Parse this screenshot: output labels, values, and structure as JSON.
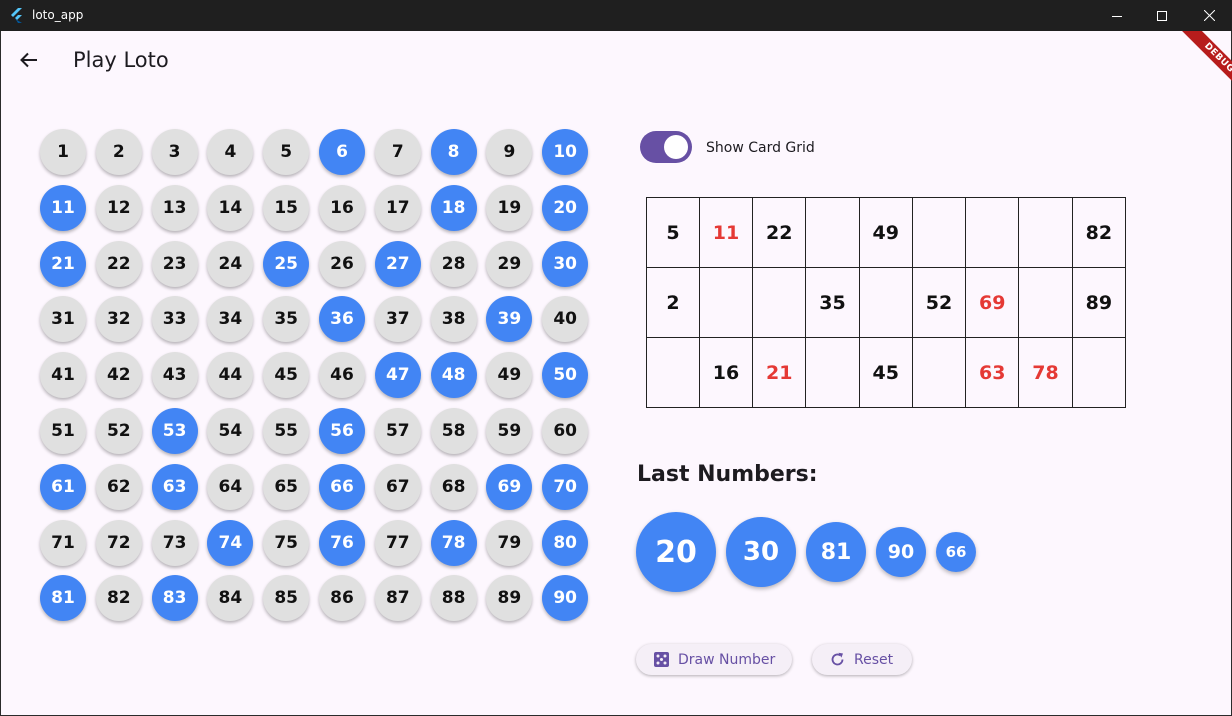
{
  "window": {
    "title": "loto_app",
    "icon": "flutter-logo-icon"
  },
  "appbar": {
    "title": "Play Loto",
    "back_icon": "arrow-back-icon"
  },
  "debug_banner": "DEBUG",
  "board": {
    "numbers": [
      1,
      2,
      3,
      4,
      5,
      6,
      7,
      8,
      9,
      10,
      11,
      12,
      13,
      14,
      15,
      16,
      17,
      18,
      19,
      20,
      21,
      22,
      23,
      24,
      25,
      26,
      27,
      28,
      29,
      30,
      31,
      32,
      33,
      34,
      35,
      36,
      37,
      38,
      39,
      40,
      41,
      42,
      43,
      44,
      45,
      46,
      47,
      48,
      49,
      50,
      51,
      52,
      53,
      54,
      55,
      56,
      57,
      58,
      59,
      60,
      61,
      62,
      63,
      64,
      65,
      66,
      67,
      68,
      69,
      70,
      71,
      72,
      73,
      74,
      75,
      76,
      77,
      78,
      79,
      80,
      81,
      82,
      83,
      84,
      85,
      86,
      87,
      88,
      89,
      90
    ],
    "drawn": [
      6,
      8,
      10,
      11,
      18,
      20,
      21,
      25,
      27,
      30,
      36,
      39,
      47,
      48,
      50,
      53,
      56,
      61,
      63,
      66,
      69,
      70,
      74,
      76,
      78,
      80,
      81,
      83,
      90
    ]
  },
  "toggle": {
    "label": "Show Card Grid",
    "on": true
  },
  "card": {
    "rows": [
      [
        "5",
        "11",
        "22",
        "",
        "49",
        "",
        "",
        "",
        "82"
      ],
      [
        "2",
        "",
        "",
        "35",
        "",
        "52",
        "69",
        "",
        "89"
      ],
      [
        "",
        "16",
        "21",
        "",
        "45",
        "",
        "63",
        "78",
        ""
      ]
    ]
  },
  "last_numbers": {
    "title": "Last Numbers:",
    "values": [
      "20",
      "30",
      "81",
      "90",
      "66"
    ]
  },
  "buttons": {
    "draw": {
      "label": "Draw Number",
      "icon": "dice-icon"
    },
    "reset": {
      "label": "Reset",
      "icon": "refresh-icon"
    }
  },
  "colors": {
    "drawn_ball": "#4285f4",
    "undrawn_ball": "#e0e0e0",
    "hit_number": "#e53935",
    "accent": "#6750a4",
    "background": "#fdf7fe"
  }
}
